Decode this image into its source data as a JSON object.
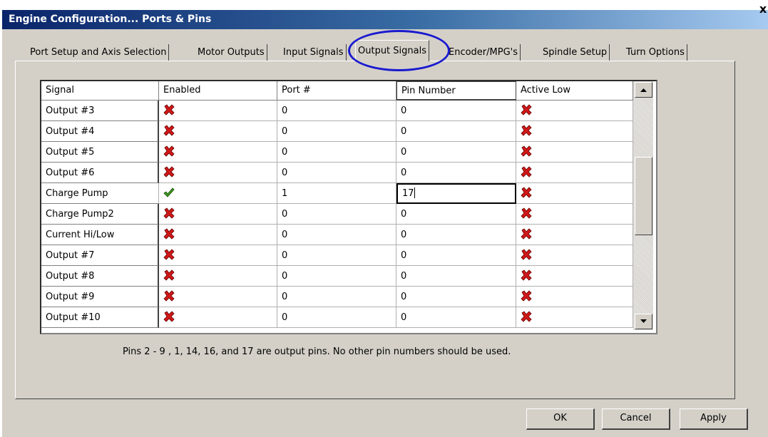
{
  "window": {
    "title": "Engine Configuration... Ports & Pins",
    "close_label": "x"
  },
  "tabs": [
    {
      "label": "Port Setup and Axis Selection",
      "active": false
    },
    {
      "label": "Motor Outputs",
      "active": false
    },
    {
      "label": "Input Signals",
      "active": false
    },
    {
      "label": "Output Signals",
      "active": true
    },
    {
      "label": "Encoder/MPG's",
      "active": false
    },
    {
      "label": "Spindle Setup",
      "active": false
    },
    {
      "label": "Turn Options",
      "active": false
    }
  ],
  "grid": {
    "columns": [
      "Signal",
      "Enabled",
      "Port #",
      "Pin Number",
      "Active Low"
    ],
    "rows": [
      {
        "signal": "Output #3",
        "enabled": false,
        "port": "0",
        "pin": "0",
        "active_low": false
      },
      {
        "signal": "Output #4",
        "enabled": false,
        "port": "0",
        "pin": "0",
        "active_low": false
      },
      {
        "signal": "Output #5",
        "enabled": false,
        "port": "0",
        "pin": "0",
        "active_low": false
      },
      {
        "signal": "Output #6",
        "enabled": false,
        "port": "0",
        "pin": "0",
        "active_low": false
      },
      {
        "signal": "Charge Pump",
        "enabled": true,
        "port": "1",
        "pin": "17",
        "active_low": false
      },
      {
        "signal": "Charge Pump2",
        "enabled": false,
        "port": "0",
        "pin": "0",
        "active_low": false
      },
      {
        "signal": "Current Hi/Low",
        "enabled": false,
        "port": "0",
        "pin": "0",
        "active_low": false
      },
      {
        "signal": "Output #7",
        "enabled": false,
        "port": "0",
        "pin": "0",
        "active_low": false
      },
      {
        "signal": "Output #8",
        "enabled": false,
        "port": "0",
        "pin": "0",
        "active_low": false
      },
      {
        "signal": "Output #9",
        "enabled": false,
        "port": "0",
        "pin": "0",
        "active_low": false
      },
      {
        "signal": "Output #10",
        "enabled": false,
        "port": "0",
        "pin": "0",
        "active_low": false
      }
    ]
  },
  "hint": "Pins 2 - 9 , 1, 14, 16, and 17 are output pins. No  other pin numbers should be used.",
  "buttons": {
    "ok": "OK",
    "cancel": "Cancel",
    "apply": "Apply"
  },
  "colors": {
    "title_bar": "#0a246a",
    "dialog_bg": "#d4d0c8",
    "check_green": "#3a9a1a",
    "x_red": "#d01818",
    "highlight": "#1a1ad0"
  }
}
